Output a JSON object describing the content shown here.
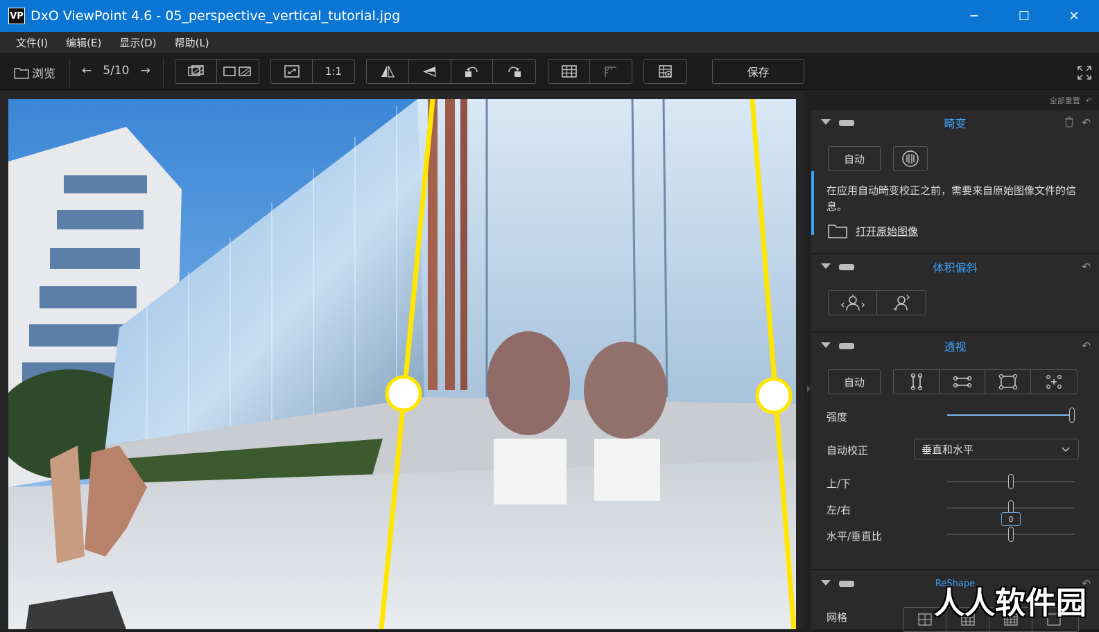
{
  "window": {
    "logo": "VP",
    "title": "DxO ViewPoint 4.6 - 05_perspective_vertical_tutorial.jpg",
    "minimize": "─",
    "maximize": "☐",
    "close": "✕"
  },
  "menu": [
    "文件(I)",
    "编辑(E)",
    "显示(D)",
    "帮助(L)"
  ],
  "toolbar": {
    "browse_label": "浏览",
    "nav_counter": "5/10",
    "prev": "←",
    "next": "→",
    "one_to_one": "1:1",
    "save_label": "保存"
  },
  "panel": {
    "top_reset_label": "全部重置",
    "distortion": {
      "title": "畸变",
      "auto_label": "自动",
      "info": "在应用自动畸变校正之前，需要来自原始图像文件的信息。",
      "open_raw_label": "打开原始图像"
    },
    "volume": {
      "title": "体积偏斜"
    },
    "perspective": {
      "title": "透视",
      "auto_label": "自动",
      "strength_label": "强度",
      "strength_value": 1.0,
      "auto_correct_label": "自动校正",
      "auto_correct_value": "垂直和水平",
      "updown_label": "上/下",
      "updown_value": 0.5,
      "leftright_label": "左/右",
      "leftright_value": 0.5,
      "leftright_readout": "0",
      "ratio_label": "水平/垂直比",
      "ratio_value": 0.5
    },
    "reshape": {
      "title": "ReShape",
      "grid_label": "网格"
    }
  },
  "watermark": "人人软件园",
  "colors": {
    "titlebar": "#0b75d3",
    "accent": "#3ea3ff",
    "guide_line": "#ffe600"
  }
}
